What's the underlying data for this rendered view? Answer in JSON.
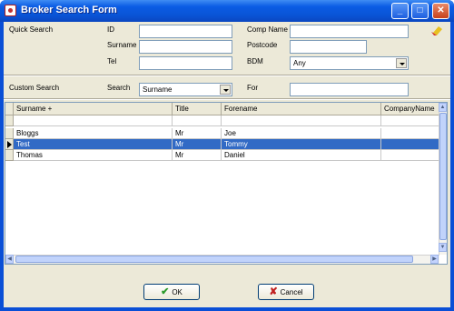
{
  "window": {
    "title": "Broker Search Form"
  },
  "quick_search": {
    "section_label": "Quick Search",
    "id_label": "ID",
    "id_value": "",
    "surname_label": "Surname",
    "surname_value": "",
    "tel_label": "Tel",
    "tel_value": "",
    "comp_name_label": "Comp Name",
    "comp_name_value": "",
    "postcode_label": "Postcode",
    "postcode_value": "",
    "bdm_label": "BDM",
    "bdm_value": "Any"
  },
  "custom_search": {
    "section_label": "Custom Search",
    "search_label": "Search",
    "search_value": "Surname",
    "for_label": "For",
    "for_value": ""
  },
  "grid": {
    "columns": [
      "Surname +",
      "Title",
      "Forename",
      "CompanyName"
    ],
    "rows": [
      {
        "surname": "Bloggs",
        "title": "Mr",
        "forename": "Joe",
        "company": ""
      },
      {
        "surname": "Test",
        "title": "Mr",
        "forename": "Tommy",
        "company": ""
      },
      {
        "surname": "Thomas",
        "title": "Mr",
        "forename": "Daniel",
        "company": ""
      }
    ],
    "selected_row": 1
  },
  "buttons": {
    "ok_label": "OK",
    "cancel_label": "Cancel"
  },
  "icons": {
    "clear": "eraser-icon",
    "ok": "checkmark-icon",
    "cancel": "cross-icon"
  },
  "colors": {
    "selection": "#316ac5",
    "titlebar": "#0a4fd6",
    "face": "#ece9d8"
  }
}
